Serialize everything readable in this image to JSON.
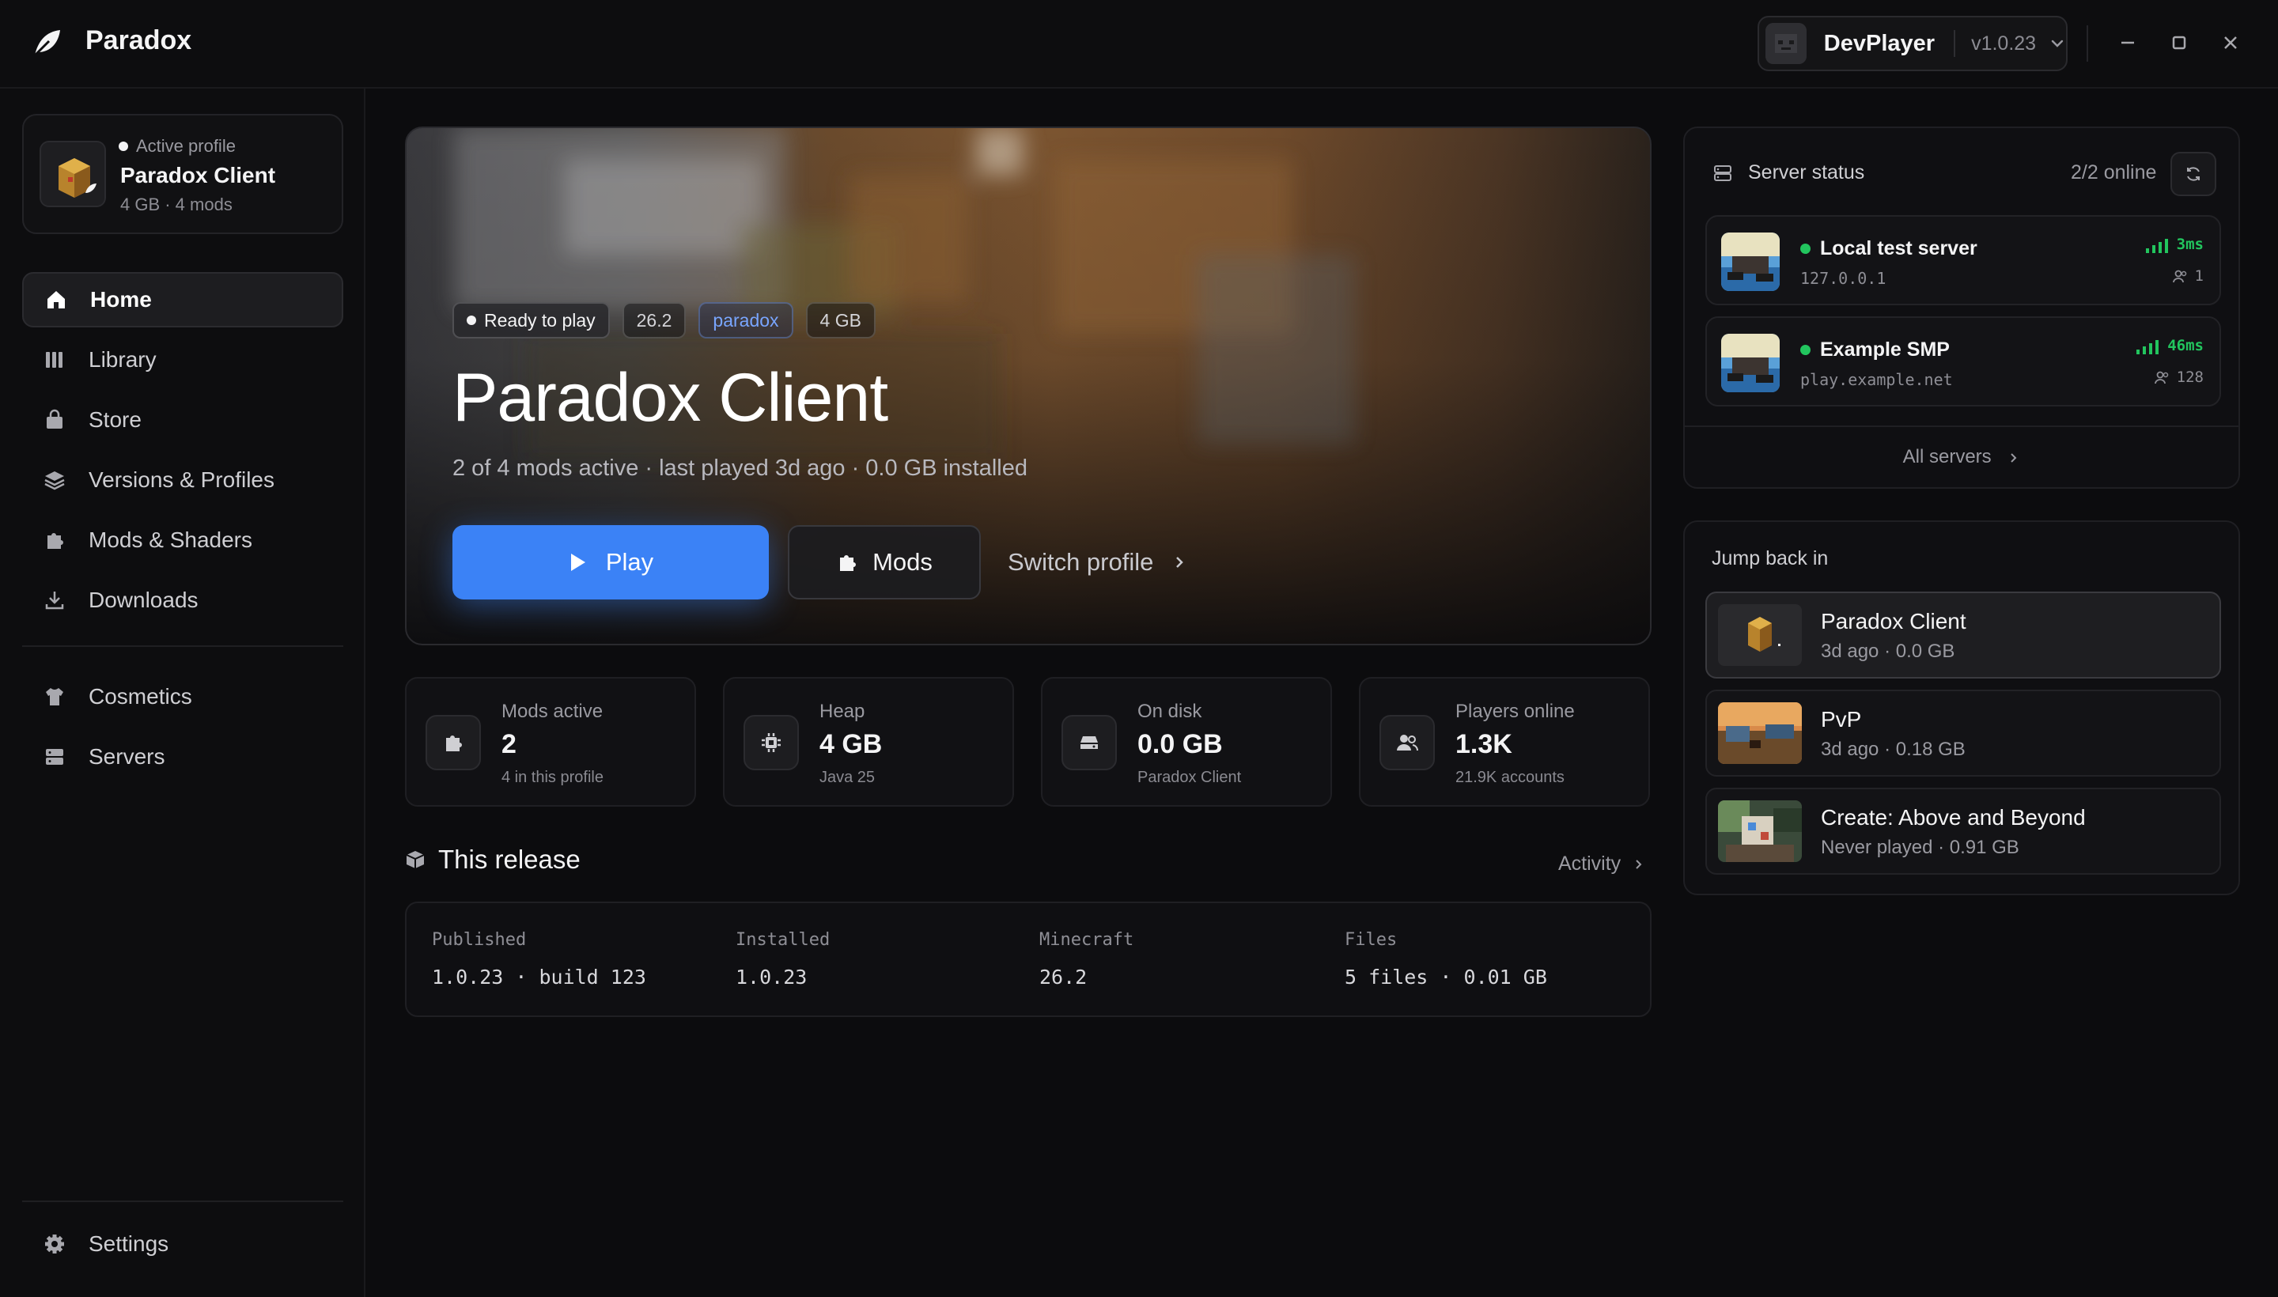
{
  "app": {
    "name": "Paradox"
  },
  "user": {
    "name": "DevPlayer",
    "version": "v1.0.23"
  },
  "sidebar": {
    "profile": {
      "label": "Active profile",
      "name": "Paradox Client",
      "meta": "4 GB · 4 mods"
    },
    "nav": [
      {
        "label": "Home",
        "icon": "home-icon",
        "active": true
      },
      {
        "label": "Library",
        "icon": "library-icon"
      },
      {
        "label": "Store",
        "icon": "store-icon"
      },
      {
        "label": "Versions & Profiles",
        "icon": "layers-icon"
      },
      {
        "label": "Mods & Shaders",
        "icon": "puzzle-icon"
      },
      {
        "label": "Downloads",
        "icon": "download-icon"
      }
    ],
    "nav2": [
      {
        "label": "Cosmetics",
        "icon": "shirt-icon"
      },
      {
        "label": "Servers",
        "icon": "server-icon"
      }
    ],
    "settings": {
      "label": "Settings",
      "icon": "gear-icon"
    }
  },
  "hero": {
    "badges": {
      "status": "Ready to play",
      "version": "26.2",
      "tag": "paradox",
      "memory": "4 GB"
    },
    "title": "Paradox Client",
    "subtitle": "2 of 4 mods active · last played 3d ago · 0.0 GB installed",
    "play_label": "Play",
    "mods_label": "Mods",
    "switch_label": "Switch profile"
  },
  "stats": [
    {
      "label": "Mods active",
      "value": "2",
      "sub": "4 in this profile",
      "icon": "puzzle-icon"
    },
    {
      "label": "Heap",
      "value": "4 GB",
      "sub": "Java 25",
      "icon": "chip-icon"
    },
    {
      "label": "On disk",
      "value": "0.0 GB",
      "sub": "Paradox Client",
      "icon": "drive-icon"
    },
    {
      "label": "Players online",
      "value": "1.3K",
      "sub": "21.9K accounts",
      "icon": "users-icon"
    }
  ],
  "release": {
    "title": "This release",
    "activity_label": "Activity",
    "cols": [
      {
        "label": "Published",
        "value": "1.0.23 · build 123"
      },
      {
        "label": "Installed",
        "value": "1.0.23"
      },
      {
        "label": "Minecraft",
        "value": "26.2"
      },
      {
        "label": "Files",
        "value": "5 files · 0.01 GB"
      }
    ]
  },
  "servers": {
    "title": "Server status",
    "count": "2/2 online",
    "items": [
      {
        "name": "Local test server",
        "address": "127.0.0.1",
        "ping": "3ms",
        "players": "1"
      },
      {
        "name": "Example SMP",
        "address": "play.example.net",
        "ping": "46ms",
        "players": "128"
      }
    ],
    "all_label": "All servers"
  },
  "jump": {
    "title": "Jump back in",
    "items": [
      {
        "name": "Paradox Client",
        "meta": "3d ago · 0.0 GB"
      },
      {
        "name": "PvP",
        "meta": "3d ago · 0.18 GB"
      },
      {
        "name": "Create: Above and Beyond",
        "meta": "Never played · 0.91 GB"
      }
    ]
  },
  "colors": {
    "accent": "#3b82f6",
    "online": "#22c55e",
    "tag_blue": "#79a6ff"
  }
}
